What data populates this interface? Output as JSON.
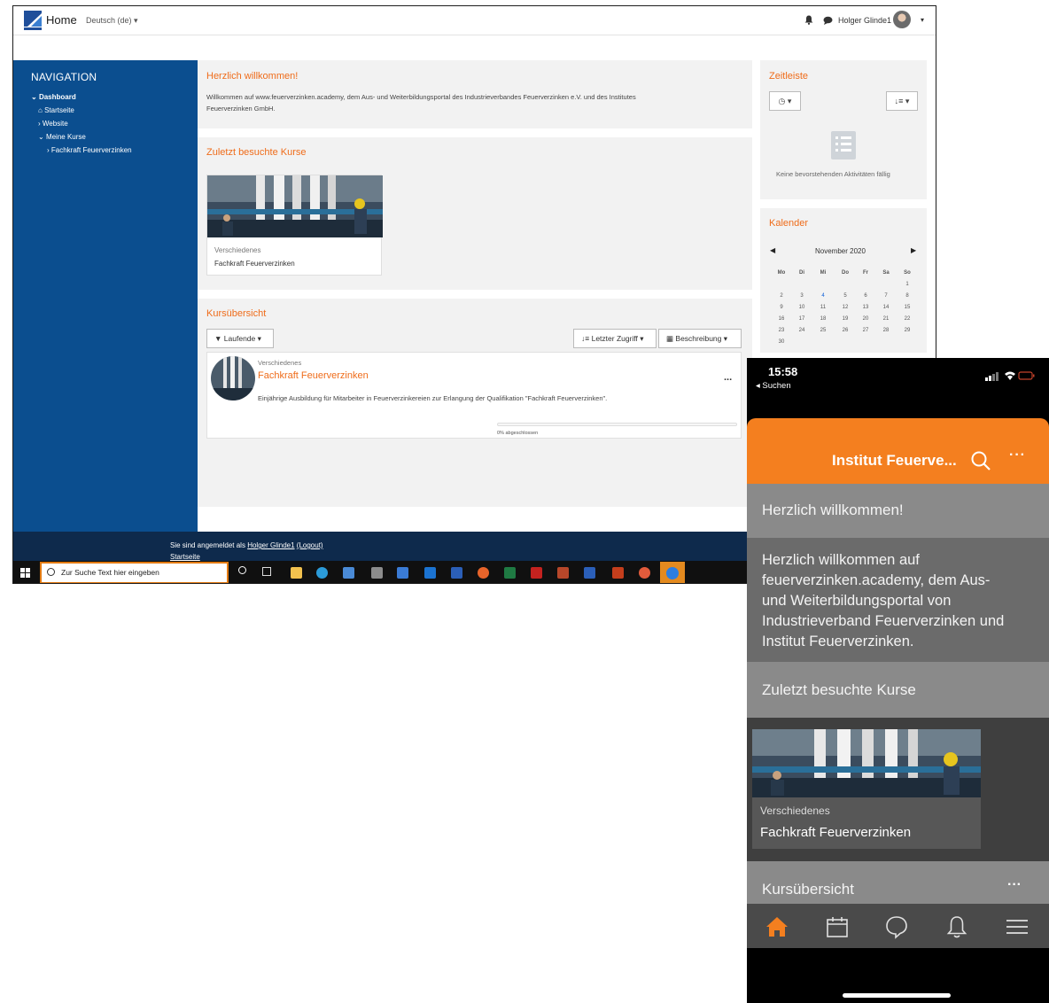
{
  "desktop": {
    "topbar": {
      "home": "Home",
      "language": "Deutsch (de)",
      "user_name": "Holger Glinde1"
    },
    "navigation": {
      "title": "NAVIGATION",
      "items": [
        "Dashboard",
        "Startseite",
        "Website",
        "Meine Kurse",
        "Fachkraft Feuerverzinken"
      ]
    },
    "welcome": {
      "title": "Herzlich willkommen!",
      "text_line1": "Willkommen auf www.feuerverzinken.academy, dem Aus- und Weiterbildungsportal des Industrieverbandes Feuerverzinken e.V. und des Institutes",
      "text_line2": "Feuerverzinken GmbH."
    },
    "recent": {
      "title": "Zuletzt besuchte Kurse",
      "course_category": "Verschiedenes",
      "course_name": "Fachkraft Feuerverzinken"
    },
    "overview": {
      "title": "Kursübersicht",
      "filter_btn": "Laufende",
      "sort_btn": "Letzter Zugriff",
      "view_btn": "Beschreibung",
      "item": {
        "category": "Verschiedenes",
        "name": "Fachkraft Feuerverzinken",
        "description": "Einjährige Ausbildung für Mitarbeiter in Feuerverzinkereien zur Erlangung der Qualifikation \"Fachkraft Feuerverzinken\".",
        "more": "...",
        "progress_label": "0% abgeschlossen",
        "progress_percent": 0
      }
    },
    "timeline": {
      "title": "Zeitleiste",
      "empty": "Keine bevorstehenden Aktivitäten fällig"
    },
    "calendar": {
      "title": "Kalender",
      "month": "November 2020",
      "weekdays": [
        "Mo",
        "Di",
        "Mi",
        "Do",
        "Fr",
        "Sa",
        "So"
      ],
      "rows": [
        [
          "",
          "",
          "",
          "",
          "",
          "",
          "1"
        ],
        [
          "2",
          "3",
          "4",
          "5",
          "6",
          "7",
          "8"
        ],
        [
          "9",
          "10",
          "11",
          "12",
          "13",
          "14",
          "15"
        ],
        [
          "16",
          "17",
          "18",
          "19",
          "20",
          "21",
          "22"
        ],
        [
          "23",
          "24",
          "25",
          "26",
          "27",
          "28",
          "29"
        ],
        [
          "30",
          "",
          "",
          "",
          "",
          "",
          ""
        ]
      ],
      "linked_day": "4"
    },
    "footer": {
      "logged_in_prefix": "Sie sind angemeldet als",
      "user_link": "Holger Glinde1",
      "logout": "(Logout)",
      "home_link": "Startseite"
    },
    "taskbar": {
      "search_placeholder": "Zur Suche Text hier eingeben"
    }
  },
  "phone": {
    "time": "15:58",
    "back_label": "◂ Suchen",
    "app_title": "Institut Feuerve...",
    "more": "···",
    "welcome_heading": "Herzlich willkommen!",
    "welcome_lines": [
      "Herzlich willkommen auf",
      "feuerverzinken.academy, dem Aus-",
      "und Weiterbildungsportal von",
      "Industrieverband Feuerverzinken und",
      "Institut Feuerverzinken."
    ],
    "recent_heading": "Zuletzt besuchte Kurse",
    "course_category": "Verschiedenes",
    "course_name": "Fachkraft Feuerverzinken",
    "overview_heading": "Kursübersicht",
    "overview_more": "···"
  },
  "colors": {
    "accent_orange": "#f47f1f",
    "nav_blue": "#0b4e8f",
    "footer_navy": "#0e2a4c"
  }
}
